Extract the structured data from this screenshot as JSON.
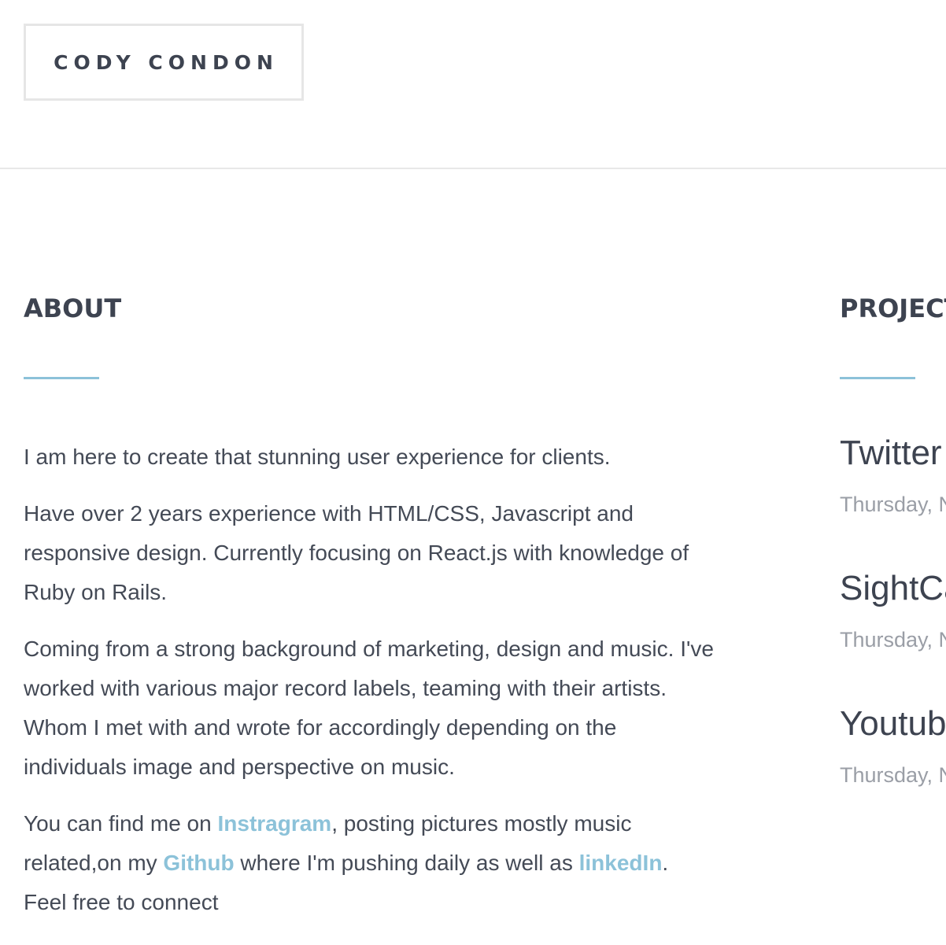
{
  "header": {
    "logo_text": "CODY CONDON"
  },
  "about": {
    "heading": "ABOUT",
    "paragraph1": "I am here to create that stunning user experience for clients.",
    "paragraph2": "Have over 2 years experience with HTML/CSS, Javascript and responsive design. Currently focusing on React.js with knowledge of Ruby on Rails.",
    "paragraph3": "Coming from a strong background of marketing, design and music. I've worked with various major record labels, teaming with their artists. Whom I met with and wrote for accordingly depending on the individuals image and perspective on music.",
    "paragraph4": {
      "text1": "You can find me on ",
      "link_instagram": "Instragram",
      "text2": ", posting pictures mostly music related,on my ",
      "link_github": "Github",
      "text3": " where I'm pushing daily as well as ",
      "link_linkedin": "linkedIn",
      "text4": ". Feel free to connect"
    }
  },
  "projects": {
    "heading": "PROJECT",
    "items": [
      {
        "title": "Twitter",
        "date": "Thursday, N"
      },
      {
        "title": "SightCa",
        "date": "Thursday, N"
      },
      {
        "title": "Youtub",
        "date": "Thursday, N"
      }
    ]
  },
  "colors": {
    "accent": "#8cc2d9",
    "text_dark": "#3d4350",
    "text_body": "#444a56",
    "text_muted": "#9a9ea6",
    "border": "#e6e6e6"
  }
}
